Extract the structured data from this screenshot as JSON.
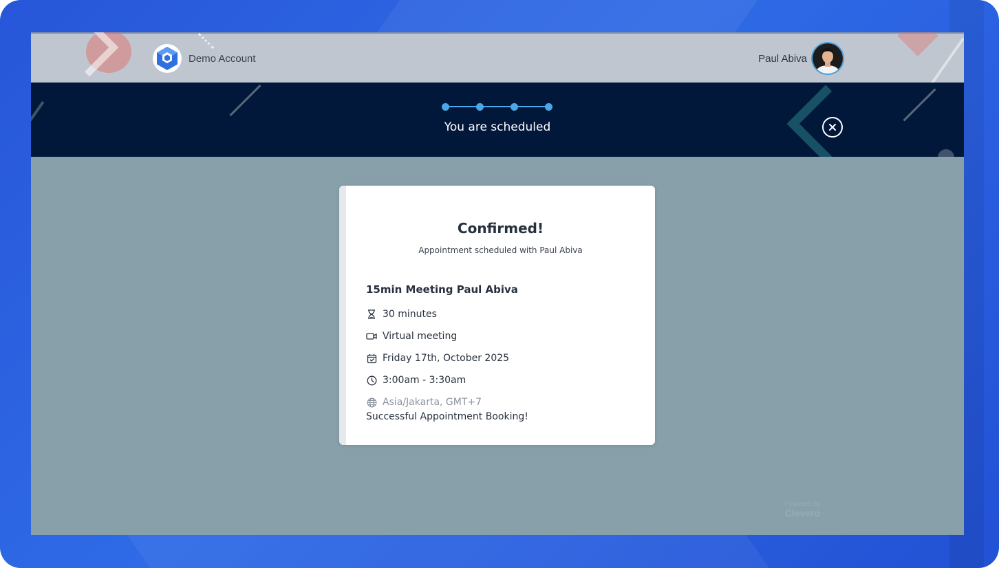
{
  "header": {
    "account_name": "Demo Account",
    "user_name": "Paul Abiva"
  },
  "banner": {
    "title": "You are scheduled",
    "steps_total": 4,
    "steps_completed": 4
  },
  "confirmation": {
    "title": "Confirmed!",
    "subtitle": "Appointment scheduled with Paul Abiva",
    "event_name": "15min Meeting Paul Abiva",
    "details": [
      {
        "icon": "hourglass-icon",
        "text": "30 minutes"
      },
      {
        "icon": "video-camera-icon",
        "text": "Virtual meeting"
      },
      {
        "icon": "calendar-icon",
        "text": "Friday 17th, October 2025"
      },
      {
        "icon": "clock-icon",
        "text": "3:00am - 3:30am"
      },
      {
        "icon": "globe-icon",
        "text": "Asia/Jakarta, GMT+7"
      }
    ],
    "success_message": "Successful Appointment Booking!"
  },
  "footer": {
    "powered_by_label": "Powered by",
    "powered_by_brand": "Clevero"
  },
  "colors": {
    "frame": "#2f6be6",
    "overlay": "#87a0aa",
    "banner": "#02183a",
    "accent": "#4aa8e8"
  }
}
